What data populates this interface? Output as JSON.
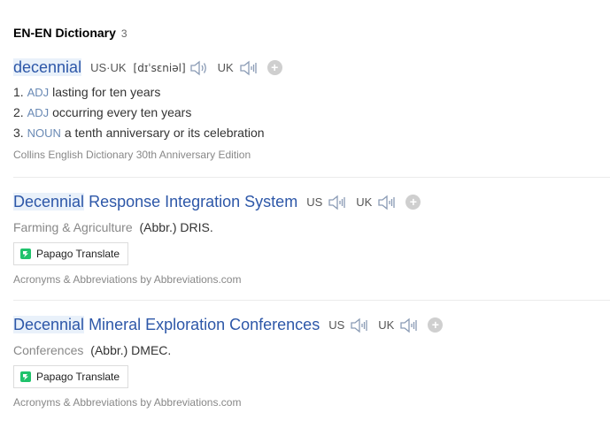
{
  "header": {
    "title": "EN-EN Dictionary",
    "count": "3"
  },
  "entry1": {
    "word": "decennial",
    "pron_us_uk_label": "US·UK",
    "ipa": "[dɪˈsɛniəl]",
    "uk_label": "UK",
    "definitions": [
      {
        "num": "1.",
        "pos": "ADJ",
        "text": "lasting for ten years"
      },
      {
        "num": "2.",
        "pos": "ADJ",
        "text": "occurring every ten years"
      },
      {
        "num": "3.",
        "pos": "NOUN",
        "text": "a tenth anniversary or its celebration"
      }
    ],
    "source": "Collins English Dictionary 30th Anniversary Edition"
  },
  "entry2": {
    "word_hl": "Decennial",
    "word_rest": " Response Integration System",
    "us_label": "US",
    "uk_label": "UK",
    "category": "Farming & Agriculture",
    "abbr": "(Abbr.) DRIS.",
    "papago": "Papago Translate",
    "source": "Acronyms & Abbreviations by Abbreviations.com"
  },
  "entry3": {
    "word_hl": "Decennial",
    "word_rest": " Mineral Exploration Conferences",
    "us_label": "US",
    "uk_label": "UK",
    "category": "Conferences",
    "abbr": "(Abbr.) DMEC.",
    "papago": "Papago Translate",
    "source": "Acronyms & Abbreviations by Abbreviations.com"
  },
  "icons": {
    "speaker": "speaker-icon",
    "plus": "add-wordbook-icon",
    "papago": "papago-logo-icon"
  },
  "colors": {
    "link": "#2d57a8",
    "highlight": "#e9f1fa",
    "pos": "#6a8ab5",
    "muted": "#888888"
  }
}
